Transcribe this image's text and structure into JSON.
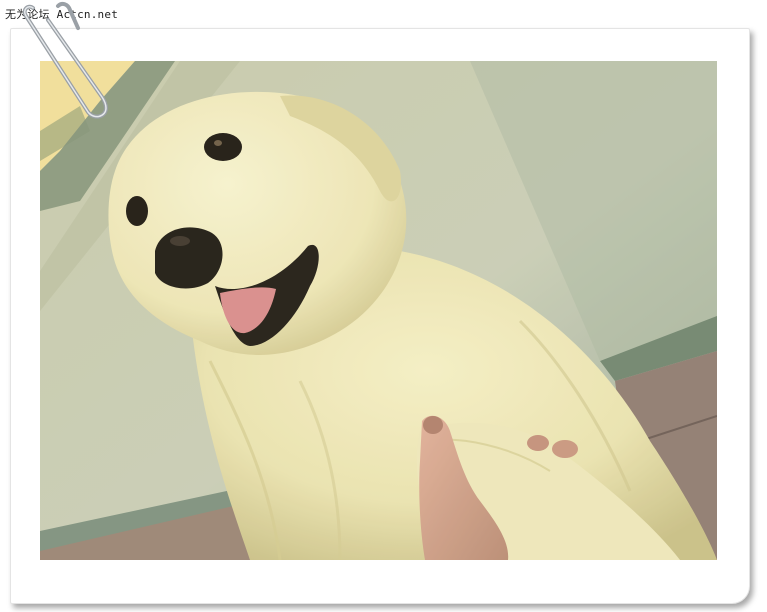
{
  "watermark": {
    "text": "无为论坛 Actcn.net"
  },
  "photo": {
    "subject": "dog-paw-handshake",
    "colors": {
      "fur": "#efe8b8",
      "fur_shadow": "#c9c08a",
      "wall": "#c8ccb6",
      "wall_dark": "#8a9a86",
      "window": "#f2df9c",
      "floor": "#9a7f74",
      "skin": "#d9a692",
      "tongue": "#d98a8e",
      "eye": "#1a1410"
    }
  },
  "frame": {
    "background": "#ffffff",
    "shadow": "#888888"
  }
}
